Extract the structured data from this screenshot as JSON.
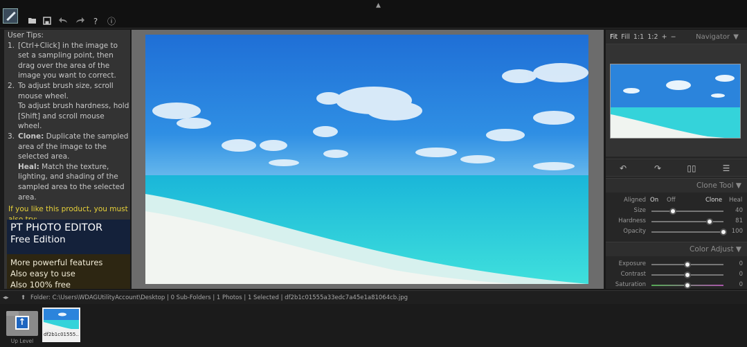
{
  "toolbar": {
    "icons": [
      "app-logo-icon",
      "open-folder-icon",
      "save-icon",
      "undo-icon",
      "redo-icon",
      "help-icon",
      "info-icon"
    ],
    "help_glyph": "?",
    "info_glyph": "ⓘ"
  },
  "tips": {
    "title": "User Tips:",
    "items": [
      {
        "num": "1.",
        "text": "[Ctrl+Click] in the image to set a sampling point, then drag over the area of the image you want to correct."
      },
      {
        "num": "2.",
        "text": "To adjust brush size, scroll mouse wheel.",
        "text2": "To adjust brush hardness, hold [Shift] and scroll mouse wheel."
      },
      {
        "num": "3.",
        "bold1": "Clone:",
        "text": "Duplicate the sampled area of the image to the selected area.",
        "bold2": "Heal:",
        "text2": "Match the texture, lighting, and shading of the sampled area to the selected area."
      }
    ],
    "promo_line": "If you like this product, you must also try:"
  },
  "promo": {
    "name": "PT PHOTO EDITOR",
    "edition": "Free Edition",
    "lines": [
      "More powerful features",
      "Also easy to use",
      "Also 100% free"
    ]
  },
  "navigator": {
    "zoom_options": [
      "Fit",
      "Fill",
      "1:1",
      "1:2",
      "+",
      "−"
    ],
    "title": "Navigator"
  },
  "clone_tool": {
    "title": "Clone Tool",
    "aligned_label": "Aligned",
    "aligned_on": "On",
    "aligned_off": "Off",
    "mode_clone": "Clone",
    "mode_heal": "Heal",
    "size_label": "Size",
    "size_value": "40",
    "size_fraction": 0.3,
    "hardness_label": "Hardness",
    "hardness_value": "81",
    "hardness_fraction": 0.81,
    "opacity_label": "Opacity",
    "opacity_value": "100",
    "opacity_fraction": 1.0
  },
  "color_adjust": {
    "title": "Color Adjust",
    "exposure_label": "Exposure",
    "exposure_value": "0",
    "contrast_label": "Contrast",
    "contrast_value": "0",
    "saturation_label": "Saturation",
    "saturation_value": "0"
  },
  "statusbar": {
    "path_text": "Folder:  C:\\Users\\WDAGUtilityAccount\\Desktop  |  0 Sub-Folders  |  1 Photos  |  1 Selected  |  df2b1c01555a33edc7a45e1a81064cb.jpg"
  },
  "filmstrip": {
    "up_level_label": "Up Level",
    "thumb_label": "df2b1c01555..."
  },
  "colors": {
    "sky": "#2a7fd4",
    "sea": "#2ad0d8",
    "sand": "#eef2ee",
    "promo_yellow": "#e8d23a"
  }
}
